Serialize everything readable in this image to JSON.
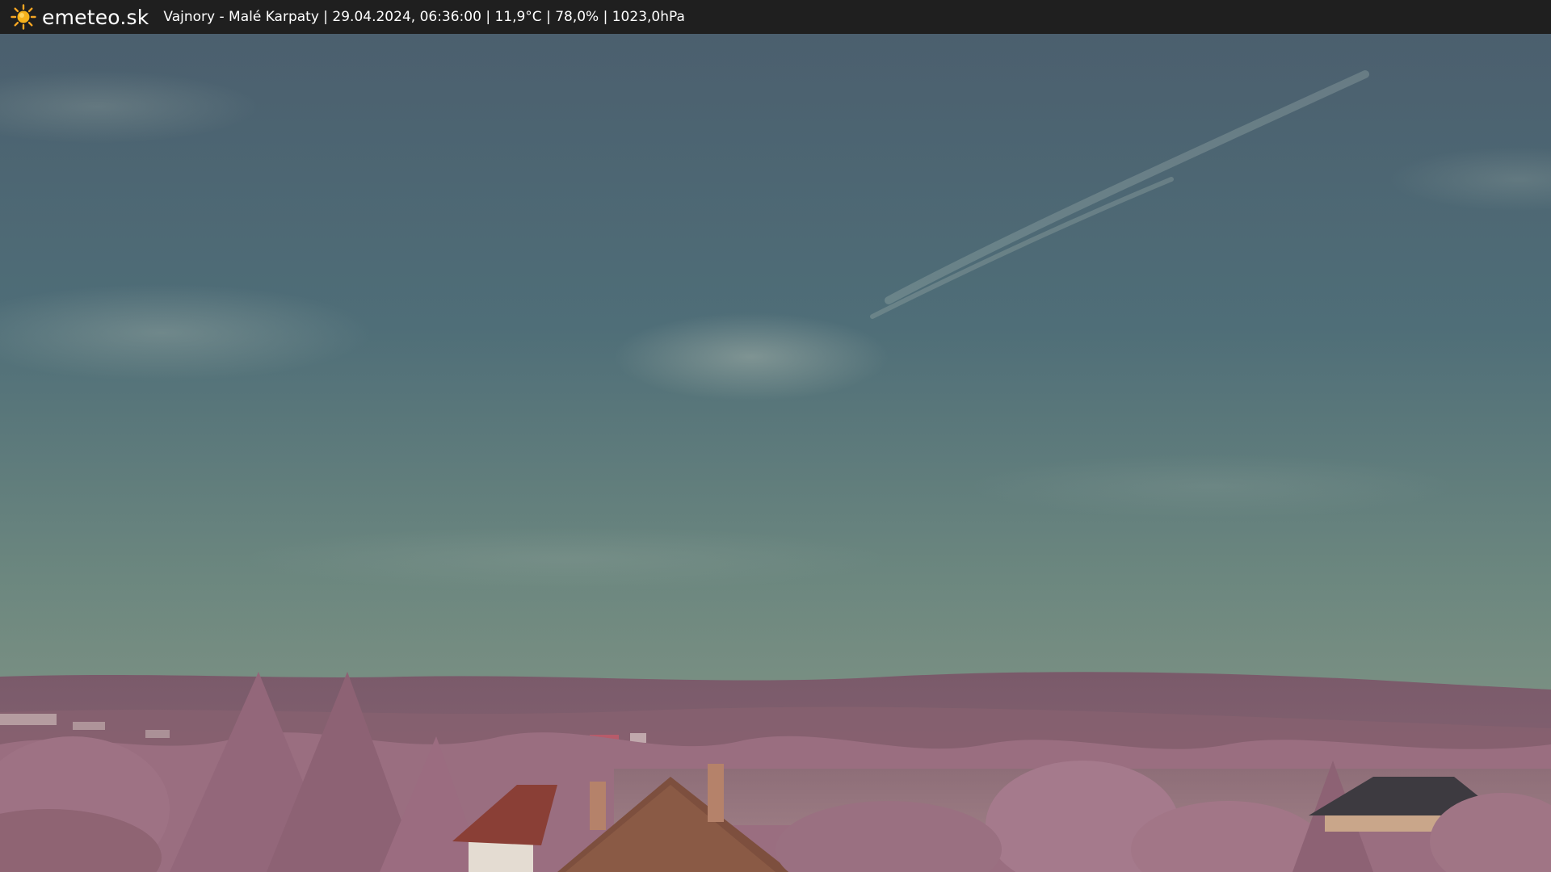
{
  "header": {
    "brand": "emeteo.sk",
    "caption": "Vajnory - Malé Karpaty | 29.04.2024, 06:36:00 | 11,9°C | 78,0% | 1023,0hPa",
    "icon": "sun-icon"
  },
  "colors": {
    "bar_background": "#1f1f1f",
    "sky_top": "#4a6373",
    "sky_bottom": "#8a9a8c",
    "hills": "#8a6577",
    "foliage": "#a67a8c",
    "roof": "#8a4a3f"
  }
}
